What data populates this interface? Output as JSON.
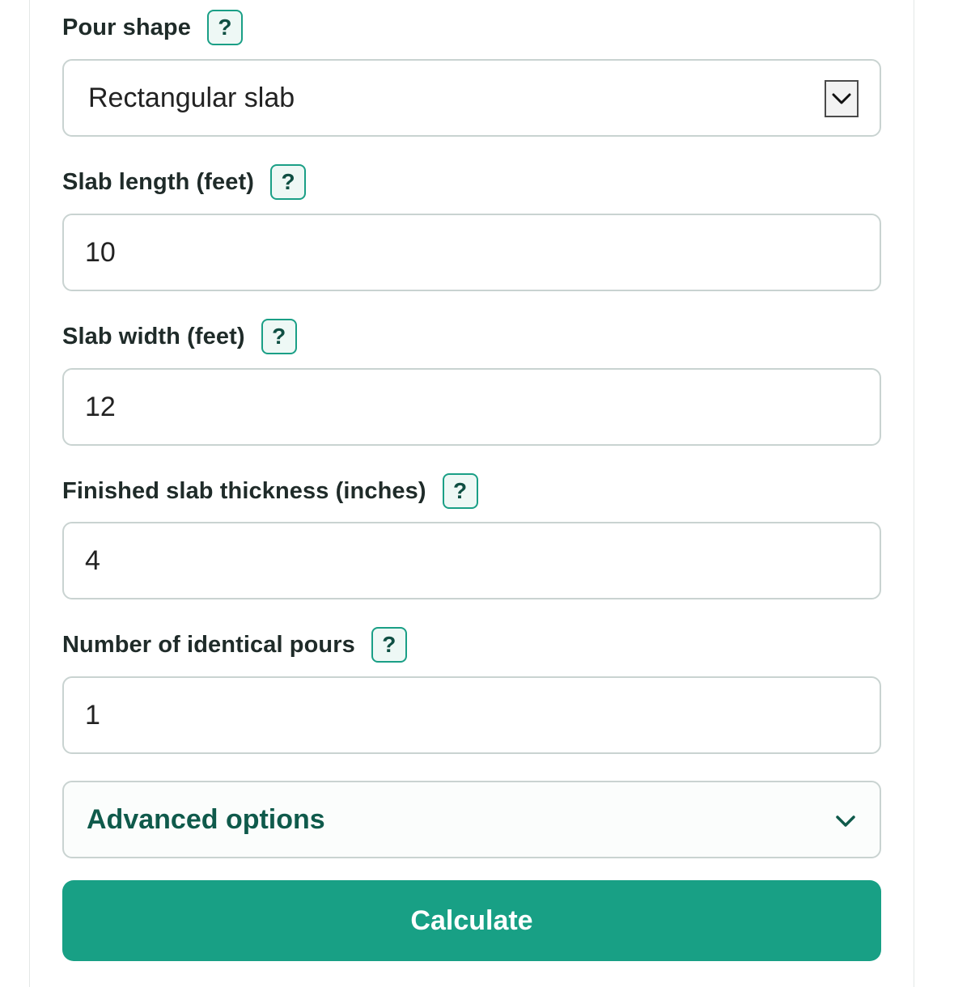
{
  "form": {
    "pour_shape": {
      "label": "Pour shape",
      "help": "?",
      "selected": "Rectangular slab"
    },
    "slab_length": {
      "label": "Slab length (feet)",
      "help": "?",
      "value": "10"
    },
    "slab_width": {
      "label": "Slab width (feet)",
      "help": "?",
      "value": "12"
    },
    "thickness": {
      "label": "Finished slab thickness (inches)",
      "help": "?",
      "value": "4"
    },
    "pours": {
      "label": "Number of identical pours",
      "help": "?",
      "value": "1"
    },
    "advanced": {
      "label": "Advanced options",
      "icon": "chevron-down-icon"
    },
    "calculate_label": "Calculate"
  },
  "colors": {
    "accent": "#18a085",
    "accent_dark": "#0f5a4b",
    "help_bg": "#eef8f5",
    "border": "#c9d3d1"
  }
}
